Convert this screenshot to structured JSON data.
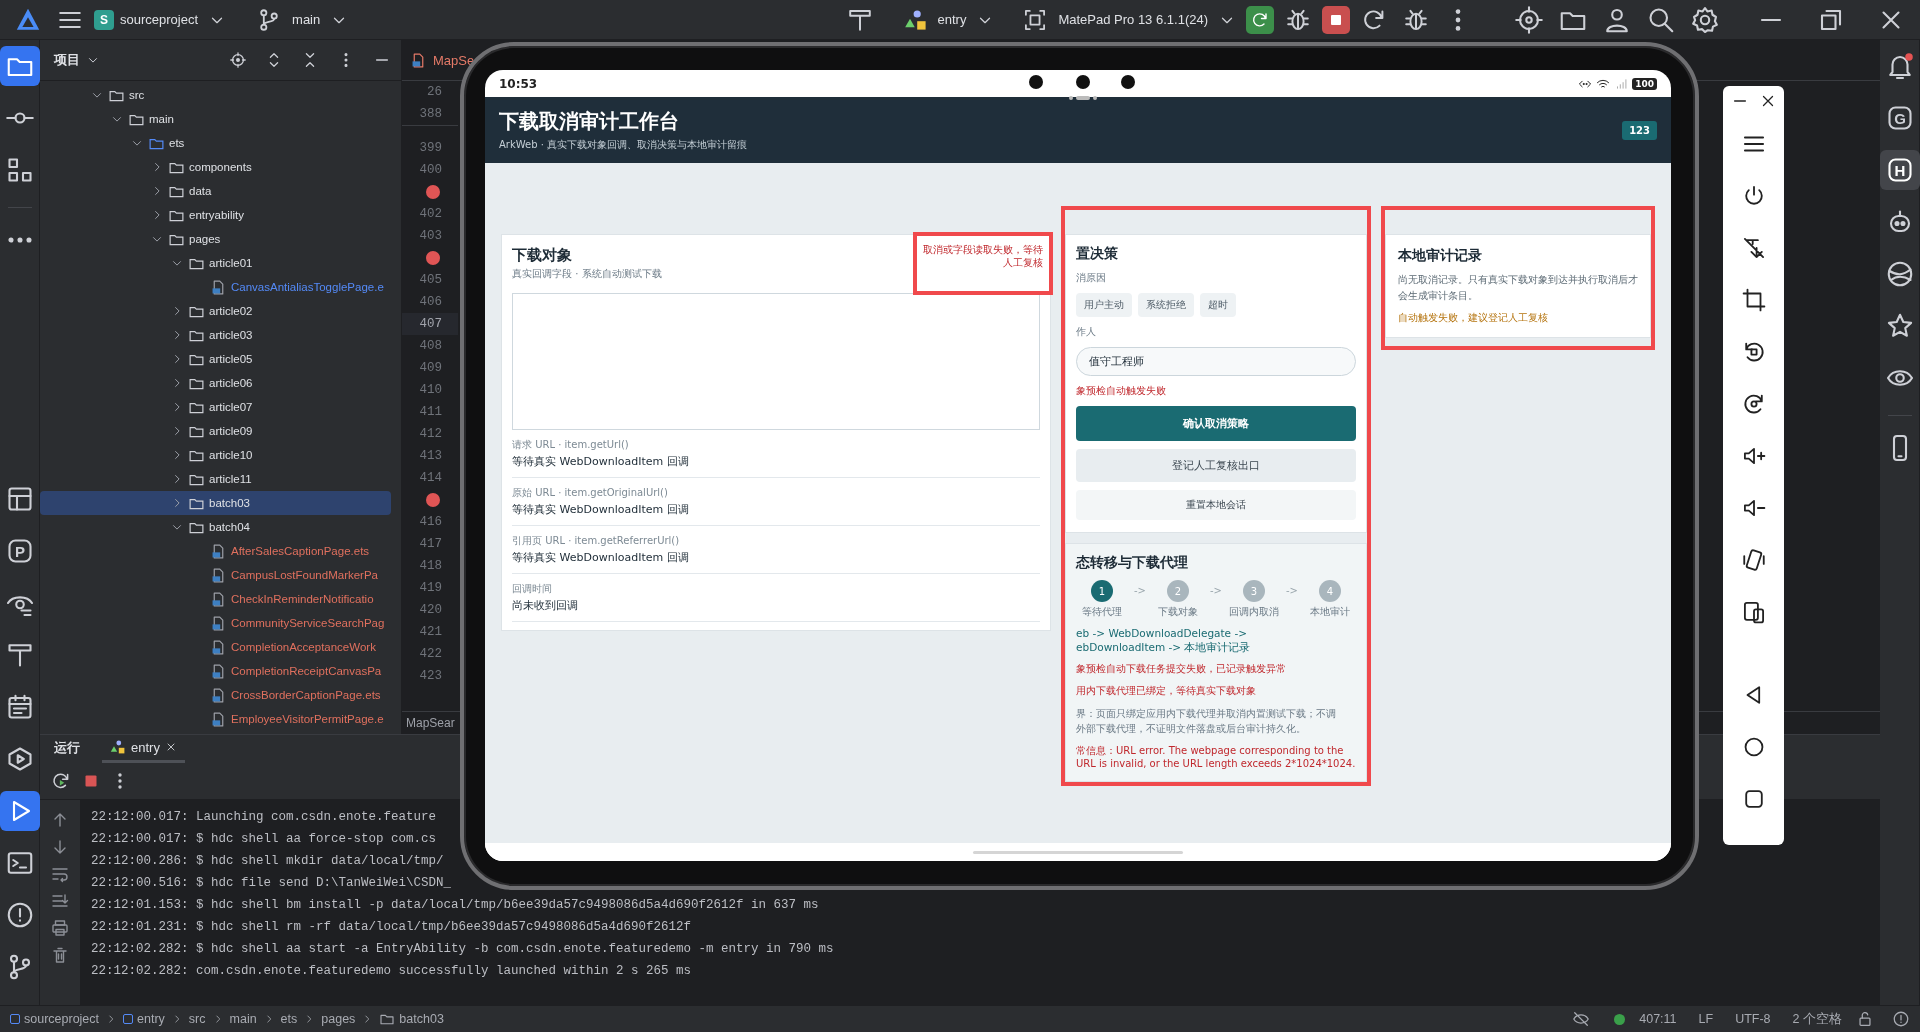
{
  "top_bar": {
    "project_badge": "S",
    "project": "sourceproject",
    "branch": "main",
    "run_config": "entry",
    "device": "MatePad Pro 13 6.1.1(24)"
  },
  "left_strip": {
    "top": [
      {
        "selected": true
      },
      {
        "selected": false
      },
      {
        "selected": false
      },
      {
        "selected": false
      }
    ],
    "bottom": [
      {
        "selected": false
      },
      {
        "selected": false,
        "letter": "P"
      },
      {
        "selected": false
      },
      {
        "selected": false
      },
      {
        "selected": false
      },
      {
        "selected": false
      },
      {
        "selected": true
      },
      {
        "selected": false
      },
      {
        "selected": false
      },
      {
        "selected": false
      }
    ]
  },
  "right_strip": [
    {
      "selected": false,
      "notification": true
    },
    {
      "selected": false,
      "letter": "G"
    },
    {
      "selected": true,
      "letter": "H"
    },
    {
      "selected": false
    },
    {
      "selected": false
    },
    {
      "selected": false
    },
    {
      "selected": false
    },
    {
      "selected": false
    }
  ],
  "project_panel": {
    "title": "项目",
    "tree": [
      {
        "name": "src",
        "kind": "folder",
        "expanded": true,
        "selected": false,
        "color": "#ced0d6",
        "children": [
          {
            "name": "main",
            "kind": "folder",
            "expanded": true,
            "selected": false,
            "color": "#ced0d6",
            "children": [
              {
                "name": "ets",
                "kind": "folder",
                "expanded": true,
                "selected": false,
                "color": "#548af7",
                "children": [
                  {
                    "name": "components",
                    "kind": "folder",
                    "expanded": false,
                    "selected": false,
                    "color": "#ced0d6"
                  },
                  {
                    "name": "data",
                    "kind": "folder",
                    "expanded": false,
                    "selected": false,
                    "color": "#ced0d6"
                  },
                  {
                    "name": "entryability",
                    "kind": "folder",
                    "expanded": false,
                    "selected": false,
                    "color": "#ced0d6"
                  },
                  {
                    "name": "pages",
                    "kind": "folder",
                    "expanded": true,
                    "selected": false,
                    "color": "#ced0d6",
                    "children": [
                      {
                        "name": "article01",
                        "kind": "folder",
                        "expanded": true,
                        "selected": false,
                        "color": "#ced0d6",
                        "children": [
                          {
                            "name": "CanvasAntialiasTogglePage.e",
                            "kind": "file",
                            "selected": false,
                            "color": "#548af7"
                          }
                        ]
                      },
                      {
                        "name": "article02",
                        "kind": "folder",
                        "expanded": false,
                        "selected": false,
                        "color": "#ced0d6"
                      },
                      {
                        "name": "article03",
                        "kind": "folder",
                        "expanded": false,
                        "selected": false,
                        "color": "#ced0d6"
                      },
                      {
                        "name": "article05",
                        "kind": "folder",
                        "expanded": false,
                        "selected": false,
                        "color": "#ced0d6"
                      },
                      {
                        "name": "article06",
                        "kind": "folder",
                        "expanded": false,
                        "selected": false,
                        "color": "#ced0d6"
                      },
                      {
                        "name": "article07",
                        "kind": "folder",
                        "expanded": false,
                        "selected": false,
                        "color": "#ced0d6"
                      },
                      {
                        "name": "article09",
                        "kind": "folder",
                        "expanded": false,
                        "selected": false,
                        "color": "#ced0d6"
                      },
                      {
                        "name": "article10",
                        "kind": "folder",
                        "expanded": false,
                        "selected": false,
                        "color": "#ced0d6"
                      },
                      {
                        "name": "article11",
                        "kind": "folder",
                        "expanded": false,
                        "selected": false,
                        "color": "#ced0d6"
                      },
                      {
                        "name": "batch03",
                        "kind": "folder",
                        "expanded": false,
                        "selected": true,
                        "color": "#ced0d6"
                      },
                      {
                        "name": "batch04",
                        "kind": "folder",
                        "expanded": true,
                        "selected": false,
                        "color": "#ced0d6",
                        "children": [
                          {
                            "name": "AfterSalesCaptionPage.ets",
                            "kind": "file",
                            "selected": false,
                            "color": "#e0705e"
                          },
                          {
                            "name": "CampusLostFoundMarkerPa",
                            "kind": "file",
                            "selected": false,
                            "color": "#e0705e"
                          },
                          {
                            "name": "CheckInReminderNotificatio",
                            "kind": "file",
                            "selected": false,
                            "color": "#e0705e"
                          },
                          {
                            "name": "CommunityServiceSearchPag",
                            "kind": "file",
                            "selected": false,
                            "color": "#e0705e"
                          },
                          {
                            "name": "CompletionAcceptanceWork",
                            "kind": "file",
                            "selected": false,
                            "color": "#e0705e"
                          },
                          {
                            "name": "CompletionReceiptCanvasPa",
                            "kind": "file",
                            "selected": false,
                            "color": "#e0705e"
                          },
                          {
                            "name": "CrossBorderCaptionPage.ets",
                            "kind": "file",
                            "selected": false,
                            "color": "#e0705e"
                          },
                          {
                            "name": "EmployeeVisitorPermitPage.e",
                            "kind": "file",
                            "selected": false,
                            "color": "#e0705e"
                          }
                        ]
                      }
                    ]
                  }
                ]
              }
            ]
          }
        ]
      }
    ]
  },
  "editor": {
    "tab": "MapSe",
    "footer": "MapSear",
    "sticky_lines": [
      {
        "kind": "number",
        "text": "26",
        "current": false
      },
      {
        "kind": "number",
        "text": "388",
        "current": false
      }
    ],
    "gutter": [
      {
        "kind": "number",
        "text": "399",
        "current": false
      },
      {
        "kind": "number",
        "text": "400",
        "current": false
      },
      {
        "kind": "breakpoint",
        "current": false
      },
      {
        "kind": "number",
        "text": "402",
        "current": false
      },
      {
        "kind": "number",
        "text": "403",
        "current": false
      },
      {
        "kind": "breakpoint",
        "current": false
      },
      {
        "kind": "number",
        "text": "405",
        "current": false
      },
      {
        "kind": "number",
        "text": "406",
        "current": false
      },
      {
        "kind": "number",
        "text": "407",
        "current": true
      },
      {
        "kind": "number",
        "text": "408",
        "current": false
      },
      {
        "kind": "number",
        "text": "409",
        "current": false
      },
      {
        "kind": "number",
        "text": "410",
        "current": false
      },
      {
        "kind": "number",
        "text": "411",
        "current": false
      },
      {
        "kind": "number",
        "text": "412",
        "current": false
      },
      {
        "kind": "number",
        "text": "413",
        "current": false
      },
      {
        "kind": "number",
        "text": "414",
        "current": false
      },
      {
        "kind": "breakpoint",
        "current": false
      },
      {
        "kind": "number",
        "text": "416",
        "current": false
      },
      {
        "kind": "number",
        "text": "417",
        "current": false
      },
      {
        "kind": "number",
        "text": "418",
        "current": false
      },
      {
        "kind": "number",
        "text": "419",
        "current": false
      },
      {
        "kind": "number",
        "text": "420",
        "current": false
      },
      {
        "kind": "number",
        "text": "421",
        "current": false
      },
      {
        "kind": "number",
        "text": "422",
        "current": false
      },
      {
        "kind": "number",
        "text": "423",
        "current": false
      }
    ]
  },
  "run_panel": {
    "title": "运行",
    "tab": "entry",
    "console": [
      "22:12:00.017: Launching com.csdn.enote.feature",
      "22:12:00.017: $ hdc shell aa force-stop com.cs",
      "22:12:00.286: $ hdc shell mkdir data/local/tmp/",
      "22:12:00.516: $ hdc file send D:\\TanWeiWei\\CSDN_",
      "22:12:01.153: $ hdc shell bm install -p data/local/tmp/b6ee39da57c9498086d5a4d690f2612f in 637 ms",
      "22:12:01.231: $ hdc shell rm -rf data/local/tmp/b6ee39da57c9498086d5a4d690f2612f",
      "22:12:02.282: $ hdc shell aa start -a EntryAbility -b com.csdn.enote.featuredemo -m entry in 790 ms",
      "22:12:02.282: com.csdn.enote.featuredemo successfully launched within 2 s 265 ms"
    ]
  },
  "status_bar": {
    "breadcrumb": [
      {
        "label": "sourceproject",
        "kind": "module"
      },
      {
        "label": "entry",
        "kind": "module"
      },
      {
        "label": "src",
        "kind": "plain"
      },
      {
        "label": "main",
        "kind": "plain"
      },
      {
        "label": "ets",
        "kind": "plain"
      },
      {
        "label": "pages",
        "kind": "plain"
      },
      {
        "label": "batch03",
        "kind": "folder"
      }
    ],
    "position": "407:11",
    "line_ending": "LF",
    "encoding": "UTF-8",
    "indent": "2 个空格"
  },
  "emulator": {
    "status_bar": {
      "time": "10:53",
      "battery": "100"
    },
    "header": {
      "title": "下载取消审计工作台",
      "subtitle": "ArkWeb · 真实下载对象回调、取消决策与本地审计留痕",
      "badge": "123"
    },
    "download_card": {
      "title": "下载对象",
      "subtitle": "真实回调字段 · 系统自动测试下载",
      "status": "取消或字段读取失败，等待人工复核",
      "fields": [
        {
          "label": "请求 URL · item.getUrl()",
          "value": "等待真实 WebDownloadItem 回调"
        },
        {
          "label": "原始 URL · item.getOriginalUrl()",
          "value": "等待真实 WebDownloadItem 回调"
        },
        {
          "label": "引用页 URL · item.getReferrerUrl()",
          "value": "等待真实 WebDownloadItem 回调"
        },
        {
          "label": "回调时间",
          "value": "尚未收到回调"
        }
      ]
    },
    "decision_card": {
      "title": "置决策",
      "reason_label": "消原因",
      "reasons": [
        {
          "label": "用户主动",
          "selected": false
        },
        {
          "label": "系统拒绝",
          "selected": false
        },
        {
          "label": "超时",
          "selected": false
        }
      ],
      "operator_label": "作人",
      "operator": {
        "value": "值守工程师"
      },
      "error": "象预检自动触发失败",
      "buttons": [
        {
          "label": "确认取消策略",
          "kind": "primary"
        },
        {
          "label": "登记人工复核出口",
          "kind": "secondary"
        },
        {
          "label": "重置本地会话",
          "kind": "tertiary"
        }
      ]
    },
    "flow_card": {
      "title": "态转移与下载代理",
      "steps": [
        {
          "number": "1",
          "label": "等待代理",
          "selected": true
        },
        {
          "number": "2",
          "label": "下载对象",
          "selected": false
        },
        {
          "number": "3",
          "label": "回调内取消",
          "selected": false
        },
        {
          "number": "4",
          "label": "本地审计",
          "selected": false
        }
      ],
      "separators": [
        "->",
        "->",
        "->"
      ],
      "path_lines": [
        "eb -> WebDownloadDelegate ->",
        "ebDownloadItem -> 本地审计记录"
      ],
      "messages": [
        "象预检自动下载任务提交失败，已记录触发异常",
        "用内下载代理已绑定，等待真实下载对象"
      ],
      "note_lines": [
        "界：页面只绑定应用内下载代理并取消内置测试下载；不调",
        "外部下载代理，不证明文件落盘或后台审计持久化。"
      ],
      "exception_lines": [
        "常信息：URL error. The webpage corresponding to the",
        "URL is invalid, or the URL length exceeds 2*1024*1024."
      ]
    },
    "audit_card": {
      "title": "本地审计记录",
      "description": "尚无取消记录。只有真实下载对象到达并执行取消后才会生成审计条目。",
      "warning": "自动触发失败，建议登记人工复核"
    }
  }
}
